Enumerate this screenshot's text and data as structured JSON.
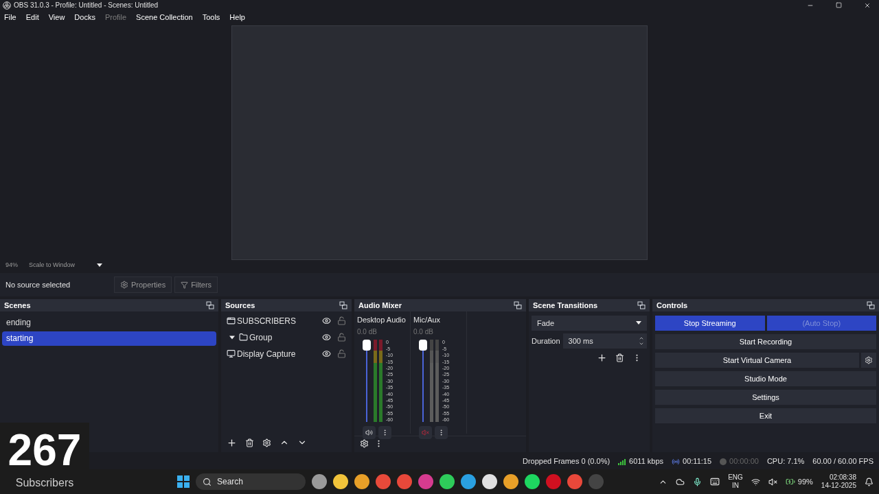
{
  "window": {
    "title": "OBS 31.0.3 - Profile: Untitled - Scenes: Untitled"
  },
  "menu": [
    {
      "label": "File",
      "disabled": false
    },
    {
      "label": "Edit",
      "disabled": false
    },
    {
      "label": "View",
      "disabled": false
    },
    {
      "label": "Docks",
      "disabled": false
    },
    {
      "label": "Profile",
      "disabled": true
    },
    {
      "label": "Scene Collection",
      "disabled": false
    },
    {
      "label": "Tools",
      "disabled": false
    },
    {
      "label": "Help",
      "disabled": false
    }
  ],
  "preview": {
    "zoom": "94%",
    "scale_mode": "Scale to Window"
  },
  "source_toolbar": {
    "status": "No source selected",
    "buttons": [
      "Properties",
      "Filters"
    ]
  },
  "scenes": {
    "title": "Scenes",
    "items": [
      {
        "label": "ending",
        "selected": false
      },
      {
        "label": "starting",
        "selected": true
      }
    ]
  },
  "sources": {
    "title": "Sources",
    "items": [
      {
        "label": "SUBSCRIBERS",
        "kind": "window",
        "visible": true,
        "locked": false
      },
      {
        "label": "Group",
        "kind": "group",
        "expanded": true,
        "visible": true,
        "locked": false
      },
      {
        "label": "Display Capture",
        "kind": "display",
        "visible": true,
        "locked": false
      }
    ]
  },
  "audio_mixer": {
    "title": "Audio Mixer",
    "channels": [
      {
        "name": "Desktop Audio",
        "reading": "0.0 dB",
        "level": 1,
        "muted": false,
        "scale": [
          "0",
          "-5",
          "-10",
          "-15",
          "-20",
          "-25",
          "-30",
          "-35",
          "-40",
          "-45",
          "-50",
          "-55",
          "-60"
        ]
      },
      {
        "name": "Mic/Aux",
        "reading": "0.0 dB",
        "level": 1,
        "muted": true,
        "scale": [
          "0",
          "-5",
          "-10",
          "-15",
          "-20",
          "-25",
          "-30",
          "-35",
          "-40",
          "-45",
          "-50",
          "-55",
          "-60"
        ]
      }
    ]
  },
  "scene_transitions": {
    "title": "Scene Transitions",
    "transition": "Fade",
    "duration_label": "Duration",
    "duration": "300 ms"
  },
  "controls": {
    "title": "Controls",
    "rows": [
      [
        {
          "label": "Stop Streaming",
          "active": true,
          "disabled": false
        },
        {
          "label": "(Auto Stop)",
          "active": true,
          "disabled": true
        }
      ],
      [
        {
          "label": "Start Recording",
          "active": false,
          "disabled": false
        }
      ],
      [
        {
          "label": "Start Virtual Camera",
          "active": false,
          "disabled": false,
          "settings": true
        }
      ],
      [
        {
          "label": "Studio Mode",
          "active": false,
          "disabled": false
        }
      ],
      [
        {
          "label": "Settings",
          "active": false,
          "disabled": false
        }
      ],
      [
        {
          "label": "Exit",
          "active": false,
          "disabled": false
        }
      ]
    ]
  },
  "status_bar": {
    "dropped_frames": "Dropped Frames 0 (0.0%)",
    "bitrate": "6011 kbps",
    "stream_time": "00:11:15",
    "record_time": "00:00:00",
    "cpu": "CPU: 7.1%",
    "fps": "60.00 / 60.00 FPS"
  },
  "overlay": {
    "count": "267",
    "label": "Subscribers"
  },
  "taskbar": {
    "search": "Search",
    "language": "ENG",
    "region": "IN",
    "battery": "99%",
    "time": "02:08:38",
    "date": "14-12-2025"
  }
}
